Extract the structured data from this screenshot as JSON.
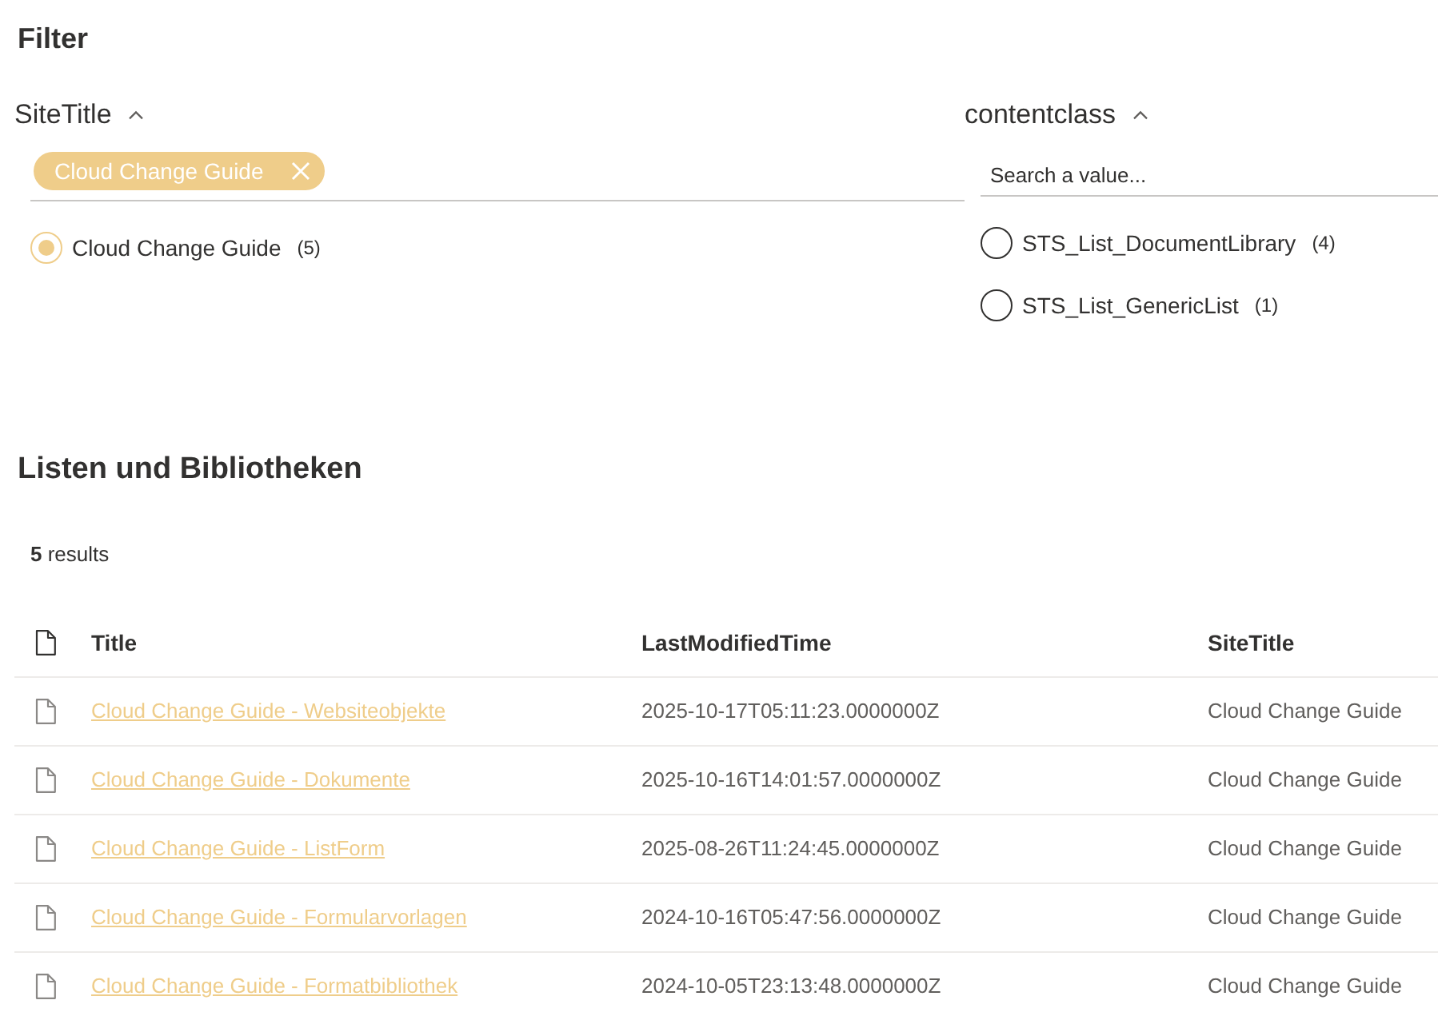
{
  "filter": {
    "title": "Filter",
    "groups": [
      {
        "kind": "chips",
        "name": "SiteTitle",
        "expanded": true,
        "chips": [
          {
            "label": "Cloud Change Guide"
          }
        ],
        "options": [
          {
            "label": "Cloud Change Guide",
            "count": "(5)",
            "selected": true
          }
        ]
      },
      {
        "kind": "search",
        "name": "contentclass",
        "expanded": true,
        "search": {
          "placeholder": "Search a value..."
        },
        "options": [
          {
            "label": "STS_List_DocumentLibrary",
            "count": "(4)",
            "selected": false
          },
          {
            "label": "STS_List_GenericList",
            "count": "(1)",
            "selected": false
          }
        ]
      }
    ]
  },
  "results": {
    "title": "Listen und Bibliotheken",
    "count": "**5** results",
    "table": {
      "columns": [
        {
          "kind": "link",
          "label": "Title"
        },
        {
          "kind": "text",
          "label": "LastModifiedTime"
        },
        {
          "kind": "text",
          "label": "SiteTitle"
        }
      ],
      "rows": [
        {
          "cells": [
            "Cloud Change Guide - Websiteobjekte",
            "2025-10-17T05:11:23.0000000Z",
            "Cloud Change Guide"
          ]
        },
        {
          "cells": [
            "Cloud Change Guide - Dokumente",
            "2025-10-16T14:01:57.0000000Z",
            "Cloud Change Guide"
          ]
        },
        {
          "cells": [
            "Cloud Change Guide - ListForm",
            "2025-08-26T11:24:45.0000000Z",
            "Cloud Change Guide"
          ]
        },
        {
          "cells": [
            "Cloud Change Guide - Formularvorlagen",
            "2024-10-16T05:47:56.0000000Z",
            "Cloud Change Guide"
          ]
        },
        {
          "cells": [
            "Cloud Change Guide - Formatbibliothek",
            "2024-10-05T23:13:48.0000000Z",
            "Cloud Change Guide"
          ]
        }
      ]
    }
  }
}
